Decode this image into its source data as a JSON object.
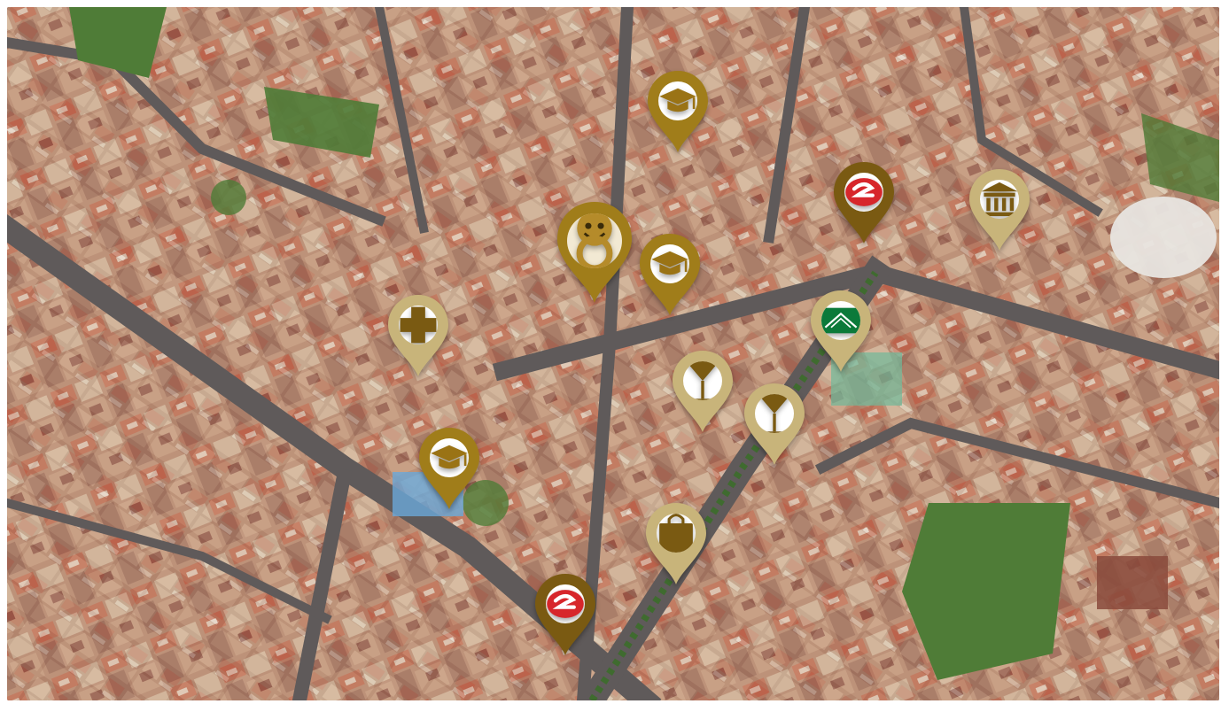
{
  "map": {
    "view": "satellite-3d-aerial",
    "colors": {
      "pin_gold": "#a07d1a",
      "pin_dark_gold": "#7a5a12",
      "pin_light_gold": "#c8b47a",
      "pin_brand_red": "#d7262b",
      "pin_store_green": "#0b7a3a"
    }
  },
  "pins": [
    {
      "id": "main-location",
      "icon": "door-knocker-icon",
      "style": "gold"
    },
    {
      "id": "university-1",
      "icon": "graduation-cap-icon",
      "style": "gold"
    },
    {
      "id": "university-2",
      "icon": "graduation-cap-icon",
      "style": "gold"
    },
    {
      "id": "university-3",
      "icon": "graduation-cap-icon",
      "style": "gold"
    },
    {
      "id": "metro-1",
      "icon": "metro-logo-icon",
      "style": "dark"
    },
    {
      "id": "metro-2",
      "icon": "metro-logo-icon",
      "style": "dark"
    },
    {
      "id": "museum",
      "icon": "museum-icon",
      "style": "light"
    },
    {
      "id": "hospital",
      "icon": "medical-cross-icon",
      "style": "light"
    },
    {
      "id": "department-store",
      "icon": "store-logo-icon",
      "style": "light"
    },
    {
      "id": "bar-1",
      "icon": "cocktail-glass-icon",
      "style": "light"
    },
    {
      "id": "bar-2",
      "icon": "cocktail-glass-icon",
      "style": "light"
    },
    {
      "id": "shopping",
      "icon": "shopping-bag-icon",
      "style": "light"
    }
  ]
}
